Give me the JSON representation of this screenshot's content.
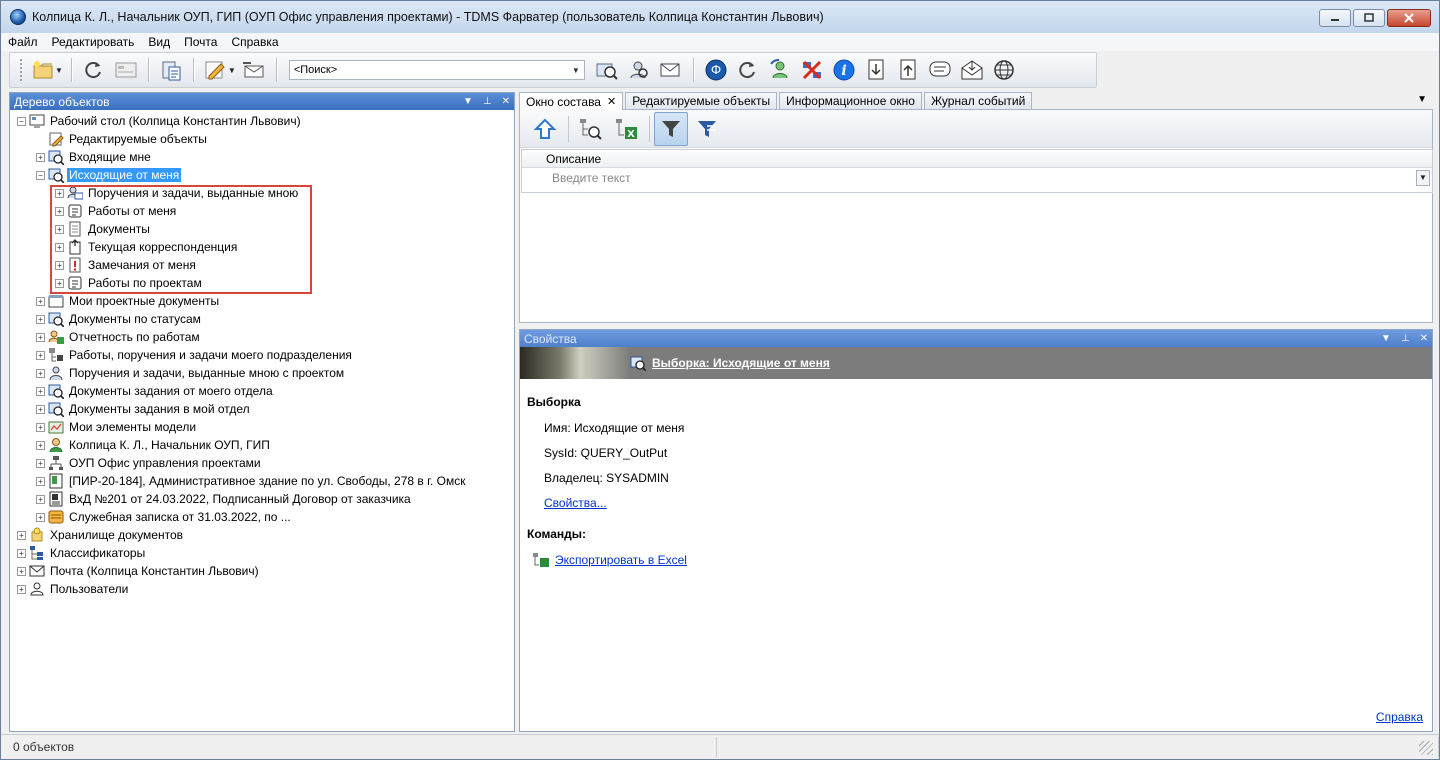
{
  "window": {
    "title": "Колпица К. Л., Начальник ОУП, ГИП (ОУП Офис управления проектами) - TDMS Фарватер (пользователь Колпица Константин Львович)"
  },
  "menu": [
    "Файл",
    "Редактировать",
    "Вид",
    "Почта",
    "Справка"
  ],
  "toolbar": {
    "search_value": "<Поиск>"
  },
  "tree_panel": {
    "title": "Дерево объектов",
    "nodes": [
      {
        "label": "Рабочий стол (Колпица Константин Львович)",
        "icon": "desktop-icon"
      },
      {
        "label": "Редактируемые объекты",
        "icon": "edit-objects-icon"
      },
      {
        "label": "Входящие мне",
        "icon": "query-icon"
      },
      {
        "label": "Исходящие от меня",
        "icon": "query-icon"
      },
      {
        "label": "Поручения и задачи, выданные мною",
        "icon": "task-icon"
      },
      {
        "label": "Работы от меня",
        "icon": "work-icon"
      },
      {
        "label": "Документы",
        "icon": "document-icon"
      },
      {
        "label": "Текущая корреспонденция",
        "icon": "correspondence-icon"
      },
      {
        "label": "Замечания от меня",
        "icon": "remark-icon"
      },
      {
        "label": "Работы по проектам",
        "icon": "work-icon"
      },
      {
        "label": "Мои проектные документы",
        "icon": "project-docs-icon"
      },
      {
        "label": "Документы по статусам",
        "icon": "query-icon"
      },
      {
        "label": "Отчетность по работам",
        "icon": "report-icon"
      },
      {
        "label": "Работы, поручения и задачи моего подразделения",
        "icon": "department-icon"
      },
      {
        "label": "Поручения и задачи, выданные мною с проектом",
        "icon": "person-task-icon"
      },
      {
        "label": "Документы задания от моего отдела",
        "icon": "query-icon"
      },
      {
        "label": "Документы задания в мой отдел",
        "icon": "query-icon"
      },
      {
        "label": "Мои элементы модели",
        "icon": "model-icon"
      },
      {
        "label": "Колпица К. Л., Начальник ОУП, ГИП",
        "icon": "user-icon"
      },
      {
        "label": "ОУП Офис управления проектами",
        "icon": "org-icon"
      },
      {
        "label": "[ПИР-20-184], Административное здание по ул. Свободы, 278 в г. Омск",
        "icon": "project-icon"
      },
      {
        "label": "ВхД №201 от 24.03.2022, Подписанный Договор от заказчика",
        "icon": "incoming-doc-icon"
      },
      {
        "label": "Служебная записка от 31.03.2022, по ...",
        "icon": "memo-icon"
      },
      {
        "label": "Хранилище документов",
        "icon": "storage-icon"
      },
      {
        "label": "Классификаторы",
        "icon": "classifier-icon"
      },
      {
        "label": "Почта (Колпица Константин Львович)",
        "icon": "mail-icon"
      },
      {
        "label": "Пользователи",
        "icon": "users-icon"
      }
    ]
  },
  "tabs": [
    {
      "label": "Окно состава"
    },
    {
      "label": "Редактируемые объекты"
    },
    {
      "label": "Информационное окно"
    },
    {
      "label": "Журнал событий"
    }
  ],
  "composition": {
    "column_header": "Описание",
    "filter_placeholder": "Введите текст"
  },
  "properties": {
    "title": "Свойства",
    "banner_link": "Выборка: Исходящие от меня",
    "section_selection": "Выборка",
    "name": "Имя: Исходящие от меня",
    "sysid": "SysId: QUERY_OutPut",
    "owner": "Владелец: SYSADMIN",
    "props_link": "Свойства...",
    "section_commands": "Команды:",
    "export_link": "Экспортировать в Excel",
    "help_link": "Справка"
  },
  "status": {
    "count_text": "0 объектов"
  },
  "colors": {
    "selection": "#3399ff",
    "highlight_box": "#d9453a",
    "panel_header": "#3a6fbf",
    "link": "#0033cc"
  }
}
